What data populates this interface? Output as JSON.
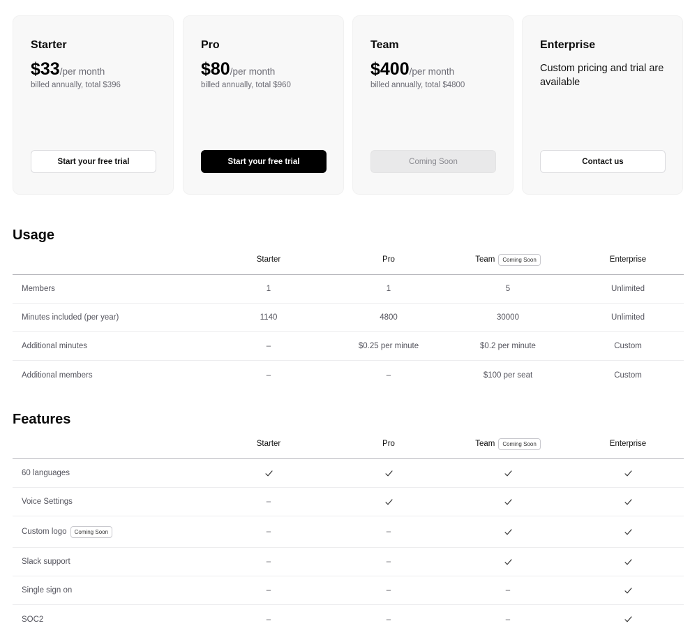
{
  "plans": [
    {
      "name": "Starter",
      "price": "$33",
      "per": "/per month",
      "billing": "billed annually, total $396",
      "button": "Start your free trial"
    },
    {
      "name": "Pro",
      "price": "$80",
      "per": "/per month",
      "billing": "billed annually, total $960",
      "button": "Start your free trial"
    },
    {
      "name": "Team",
      "price": "$400",
      "per": "/per month",
      "billing": "billed annually, total $4800",
      "button": "Coming Soon"
    },
    {
      "name": "Enterprise",
      "description": "Custom pricing and trial are available",
      "button": "Contact us"
    }
  ],
  "usage": {
    "title": "Usage",
    "columns": [
      "Starter",
      "Pro",
      "Team",
      "Enterprise"
    ],
    "team_badge": "Coming Soon",
    "rows": [
      {
        "label": "Members",
        "values": [
          "1",
          "1",
          "5",
          "Unlimited"
        ]
      },
      {
        "label": "Minutes included (per year)",
        "values": [
          "1140",
          "4800",
          "30000",
          "Unlimited"
        ]
      },
      {
        "label": "Additional minutes",
        "values": [
          "–",
          "$0.25 per minute",
          "$0.2 per minute",
          "Custom"
        ]
      },
      {
        "label": "Additional members",
        "values": [
          "–",
          "–",
          "$100 per seat",
          "Custom"
        ]
      }
    ]
  },
  "features": {
    "title": "Features",
    "columns": [
      "Starter",
      "Pro",
      "Team",
      "Enterprise"
    ],
    "team_badge": "Coming Soon",
    "rows": [
      {
        "label": "60 languages",
        "values": [
          "check",
          "check",
          "check",
          "check"
        ]
      },
      {
        "label": "Voice Settings",
        "values": [
          "–",
          "check",
          "check",
          "check"
        ]
      },
      {
        "label": "Custom logo",
        "badge": "Coming Soon",
        "values": [
          "–",
          "–",
          "check",
          "check"
        ]
      },
      {
        "label": "Slack support",
        "values": [
          "–",
          "–",
          "check",
          "check"
        ]
      },
      {
        "label": "Single sign on",
        "values": [
          "–",
          "–",
          "–",
          "check"
        ]
      },
      {
        "label": "SOC2",
        "values": [
          "–",
          "–",
          "–",
          "check"
        ]
      }
    ]
  },
  "icons": {
    "check": "check-icon"
  }
}
